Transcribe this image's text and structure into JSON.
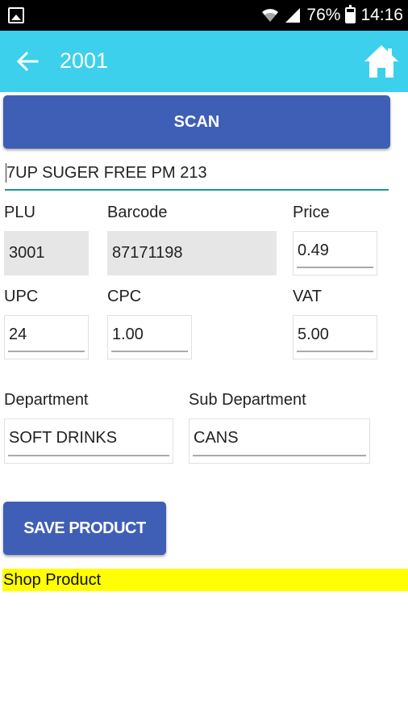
{
  "status_bar": {
    "battery": "76%",
    "time": "14:16"
  },
  "app_bar": {
    "title": "2001"
  },
  "scan_button": "SCAN",
  "product_name": "7UP SUGER FREE PM 213",
  "fields": {
    "plu": {
      "label": "PLU",
      "value": "3001"
    },
    "barcode": {
      "label": "Barcode",
      "value": "87171198"
    },
    "price": {
      "label": "Price",
      "value": "0.49"
    },
    "upc": {
      "label": "UPC",
      "value": "24"
    },
    "cpc": {
      "label": "CPC",
      "value": "1.00"
    },
    "vat": {
      "label": "VAT",
      "value": "5.00"
    },
    "department": {
      "label": "Department",
      "value": "SOFT DRINKS"
    },
    "sub_department": {
      "label": "Sub Department",
      "value": "CANS"
    }
  },
  "save_button": "SAVE PRODUCT",
  "footer_label": "Shop Product",
  "colors": {
    "app_bar": "#3dd0ec",
    "button": "#3f5fb6",
    "highlight": "#ffff00",
    "underline_active": "#169a88"
  },
  "icons": [
    "gallery-icon",
    "wifi-icon",
    "signal-icon",
    "battery-icon",
    "back-arrow-icon",
    "home-icon"
  ]
}
